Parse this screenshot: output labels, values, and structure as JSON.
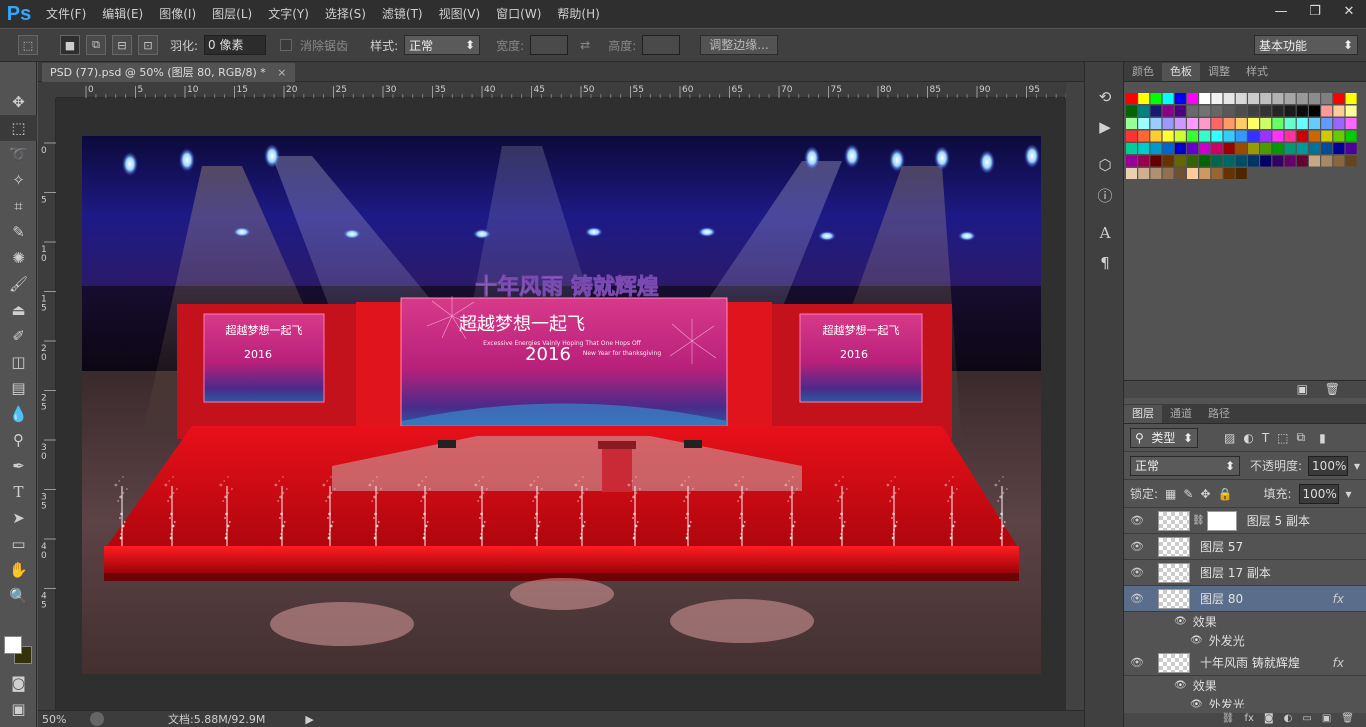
{
  "app": {
    "logo": "Ps",
    "menu": [
      "文件(F)",
      "编辑(E)",
      "图像(I)",
      "图层(L)",
      "文字(Y)",
      "选择(S)",
      "滤镜(T)",
      "视图(V)",
      "窗口(W)",
      "帮助(H)"
    ],
    "window_controls": [
      "—",
      "❐",
      "✕"
    ]
  },
  "options": {
    "feather_label": "羽化:",
    "feather_value": "0 像素",
    "antialias_label": "消除锯齿",
    "style_label": "样式:",
    "style_value": "正常",
    "width_label": "宽度:",
    "height_label": "高度:",
    "refine_button": "调整边缘...",
    "workspace": "基本功能"
  },
  "document": {
    "tab_title": "PSD (77).psd @ 50% (图层 80, RGB/8) *",
    "close": "×",
    "zoom": "50%",
    "doc_info": "文档:5.88M/92.9M",
    "ruler_h": [
      "0",
      "5",
      "10",
      "15",
      "20",
      "25",
      "30",
      "35",
      "40",
      "45",
      "50",
      "55",
      "60",
      "65",
      "70",
      "75",
      "80",
      "85",
      "90",
      "95"
    ],
    "ruler_v": [
      "0",
      "5",
      "1\n0",
      "1\n5",
      "2\n0",
      "2\n5",
      "3\n0",
      "3\n5",
      "4\n0",
      "4\n5"
    ]
  },
  "artwork": {
    "headline": "十年风雨  铸就辉煌",
    "center_screen_title": "超越梦想一起飞",
    "center_screen_subtitle": "Excessive Energies Vainly Hoping That One Hops Off",
    "center_screen_year": "2016",
    "center_screen_tagline": "New Year for thanksgiving",
    "side_screen_title": "超越梦想一起飞",
    "side_screen_year": "2016"
  },
  "panels": {
    "top_tabs": [
      "颜色",
      "色板",
      "调整",
      "样式"
    ],
    "top_active": "色板",
    "layer_tabs": [
      "图层",
      "通道",
      "路径"
    ],
    "layer_active": "图层",
    "filter_kind": "类型",
    "blend_mode": "正常",
    "opacity_label": "不透明度:",
    "opacity_value": "100%",
    "lock_label": "锁定:",
    "fill_label": "填充:",
    "fill_value": "100%",
    "layers": [
      {
        "name": "图层 5 副本",
        "mask": true,
        "fx": false,
        "selected": false
      },
      {
        "name": "图层 57",
        "mask": false,
        "fx": false,
        "selected": false
      },
      {
        "name": "图层 17 副本",
        "mask": false,
        "fx": false,
        "selected": false
      },
      {
        "name": "图层 80",
        "mask": false,
        "fx": true,
        "selected": true
      },
      {
        "name": "十年风雨  铸就辉煌",
        "mask": false,
        "fx": true,
        "selected": false
      }
    ],
    "effects_label": "效果",
    "outer_glow_label": "外发光",
    "fx_mark": "fx"
  },
  "swatch_colors": [
    [
      "#ff0000",
      "#ffff00",
      "#00ff00",
      "#00ffff",
      "#0000ff",
      "#ff00ff",
      "#ffffff",
      "#f2f2f2",
      "#e6e6e6",
      "#d9d9d9",
      "#cccccc",
      "#bfbfbf",
      "#b3b3b3",
      "#a6a6a6",
      "#999999",
      "#8c8c8c",
      "#808080",
      "#ff0000",
      "#ffff00"
    ],
    [
      "#006400",
      "#008080",
      "#191970",
      "#8b008b",
      "#4b0082",
      "#696969",
      "#737373",
      "#666666",
      "#595959",
      "#4d4d4d",
      "#404040",
      "#333333",
      "#262626",
      "#1a1a1a",
      "#0d0d0d",
      "#000000",
      "#ff9999",
      "#ffcc99",
      "#ffff99"
    ],
    [
      "#99ff99",
      "#99ffff",
      "#99ccff",
      "#9999ff",
      "#cc99ff",
      "#ff99ff",
      "#ff99cc",
      "#ff6666",
      "#ff9966",
      "#ffcc66",
      "#ffff66",
      "#ccff66",
      "#66ff66",
      "#66ffcc",
      "#66ffff",
      "#66ccff",
      "#6699ff",
      "#9966ff",
      "#ff66ff"
    ],
    [
      "#ff3333",
      "#ff6633",
      "#ffcc33",
      "#ffff33",
      "#ccff33",
      "#33ff33",
      "#33ffcc",
      "#33ffff",
      "#33ccff",
      "#3399ff",
      "#3333ff",
      "#9933ff",
      "#ff33ff",
      "#ff3399",
      "#cc0000",
      "#cc6600",
      "#cccc00",
      "#66cc00",
      "#00cc00"
    ],
    [
      "#00cc99",
      "#00cccc",
      "#0099cc",
      "#0066cc",
      "#0000cc",
      "#6600cc",
      "#cc00cc",
      "#cc0066",
      "#990000",
      "#994c00",
      "#999900",
      "#4c9900",
      "#009900",
      "#009973",
      "#009999",
      "#007399",
      "#004c99",
      "#000099",
      "#4c0099"
    ],
    [
      "#990099",
      "#99004c",
      "#660000",
      "#663300",
      "#666600",
      "#336600",
      "#006600",
      "#00664d",
      "#006666",
      "#004d66",
      "#003366",
      "#000066",
      "#330066",
      "#660066",
      "#660033",
      "#c8a882",
      "#a88860",
      "#886640",
      "#664420"
    ],
    [
      "#e8d0b0",
      "#d0b090",
      "#b09070",
      "#907050",
      "#705030",
      "#ffcc99",
      "#cc9966",
      "#996633",
      "#663300",
      "#4d2600"
    ]
  ]
}
